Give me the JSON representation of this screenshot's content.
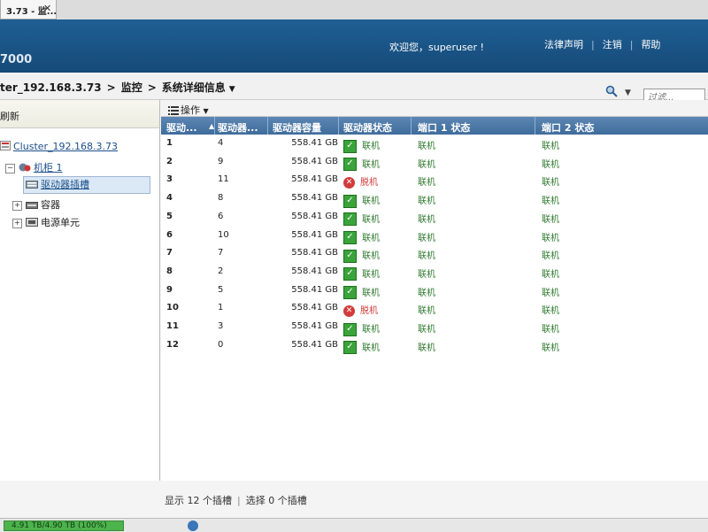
{
  "tab": {
    "title": "3.73 - 监...",
    "close": "✕"
  },
  "banner": {
    "product": "7000",
    "welcome": "欢迎您，superuser !",
    "links": [
      "法律声明",
      "注销",
      "帮助"
    ]
  },
  "breadcrumb": {
    "items": [
      "ter_192.168.3.73",
      "监控",
      "系统详细信息"
    ],
    "dropdown": "▼"
  },
  "search": {
    "placeholder": "过滤..."
  },
  "left_panel": {
    "refresh": "刷新",
    "tree": {
      "cluster": "Cluster_192.168.3.73",
      "cabinet": "机柜 1",
      "selected": "驱动器插槽",
      "container": "容器",
      "power": "电源单元"
    }
  },
  "toolbar": {
    "operations": "操作"
  },
  "table": {
    "columns": [
      "驱动...",
      "驱动器...",
      "驱动器容量",
      "驱动器状态",
      "端口 1 状态",
      "端口 2 状态"
    ],
    "rows": [
      {
        "slot": "1",
        "drive": "4",
        "capacity": "558.41 GB",
        "status": "联机",
        "status_ok": true,
        "port1": "联机",
        "port2": "联机"
      },
      {
        "slot": "2",
        "drive": "9",
        "capacity": "558.41 GB",
        "status": "联机",
        "status_ok": true,
        "port1": "联机",
        "port2": "联机"
      },
      {
        "slot": "3",
        "drive": "11",
        "capacity": "558.41 GB",
        "status": "脱机",
        "status_ok": false,
        "port1": "联机",
        "port2": "联机"
      },
      {
        "slot": "4",
        "drive": "8",
        "capacity": "558.41 GB",
        "status": "联机",
        "status_ok": true,
        "port1": "联机",
        "port2": "联机"
      },
      {
        "slot": "5",
        "drive": "6",
        "capacity": "558.41 GB",
        "status": "联机",
        "status_ok": true,
        "port1": "联机",
        "port2": "联机"
      },
      {
        "slot": "6",
        "drive": "10",
        "capacity": "558.41 GB",
        "status": "联机",
        "status_ok": true,
        "port1": "联机",
        "port2": "联机"
      },
      {
        "slot": "7",
        "drive": "7",
        "capacity": "558.41 GB",
        "status": "联机",
        "status_ok": true,
        "port1": "联机",
        "port2": "联机"
      },
      {
        "slot": "8",
        "drive": "2",
        "capacity": "558.41 GB",
        "status": "联机",
        "status_ok": true,
        "port1": "联机",
        "port2": "联机"
      },
      {
        "slot": "9",
        "drive": "5",
        "capacity": "558.41 GB",
        "status": "联机",
        "status_ok": true,
        "port1": "联机",
        "port2": "联机"
      },
      {
        "slot": "10",
        "drive": "1",
        "capacity": "558.41 GB",
        "status": "脱机",
        "status_ok": false,
        "port1": "联机",
        "port2": "联机"
      },
      {
        "slot": "11",
        "drive": "3",
        "capacity": "558.41 GB",
        "status": "联机",
        "status_ok": true,
        "port1": "联机",
        "port2": "联机"
      },
      {
        "slot": "12",
        "drive": "0",
        "capacity": "558.41 GB",
        "status": "联机",
        "status_ok": true,
        "port1": "联机",
        "port2": "联机"
      }
    ]
  },
  "status": {
    "shown": "显示 12 个插槽",
    "selected": "选择 0 个插槽"
  },
  "storage": {
    "text": "4.91 TB/4.90 TB (100%)",
    "fraction": 1.0
  },
  "colors": {
    "banner": "#1f5f94",
    "header": "#3f6c9c",
    "ok": "#2f7a2f",
    "bad": "#d23b3b"
  }
}
